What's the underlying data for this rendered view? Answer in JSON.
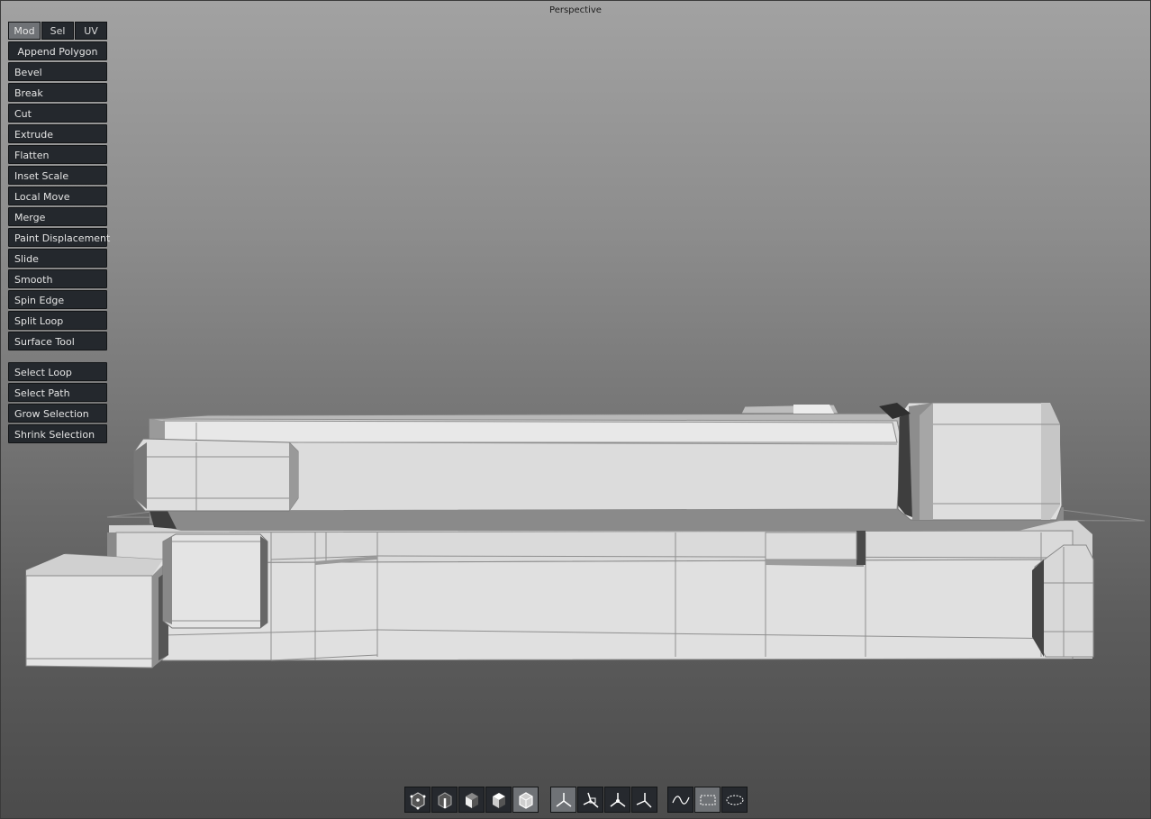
{
  "viewport": {
    "title": "Perspective"
  },
  "tabs": [
    {
      "label": "Mod",
      "active": true
    },
    {
      "label": "Sel",
      "active": false
    },
    {
      "label": "UV",
      "active": false
    }
  ],
  "modeling_tools": [
    "Append Polygon",
    "Bevel",
    "Break",
    "Cut",
    "Extrude",
    "Flatten",
    "Inset Scale",
    "Local Move",
    "Merge",
    "Paint Displacement",
    "Slide",
    "Smooth",
    "Spin Edge",
    "Split Loop",
    "Surface Tool"
  ],
  "selection_tools": [
    "Select Loop",
    "Select Path",
    "Grow Selection",
    "Shrink Selection"
  ],
  "bottom_toolbar": {
    "selection_modes": [
      "vertex-mode-icon",
      "edge-mode-icon",
      "face-mode-icon",
      "object-mode-icon",
      "solid-object-mode-icon"
    ],
    "active_selection_mode": "solid-object-mode-icon",
    "transform_spaces": [
      "world-axis-icon",
      "local-axis-icon",
      "screen-axis-icon",
      "object-axis-icon"
    ],
    "active_transform_space": "world-axis-icon",
    "marquee_modes": [
      "lasso-curve-icon",
      "rectangle-marquee-icon",
      "ellipse-marquee-icon"
    ],
    "active_marquee_mode": "rectangle-marquee-icon"
  },
  "colors": {
    "panel": "#24282d",
    "active": "#6f7276",
    "mesh_face": "#dedede",
    "mesh_side": "#8a8a8a",
    "mesh_edge": "#7a7a7a"
  }
}
